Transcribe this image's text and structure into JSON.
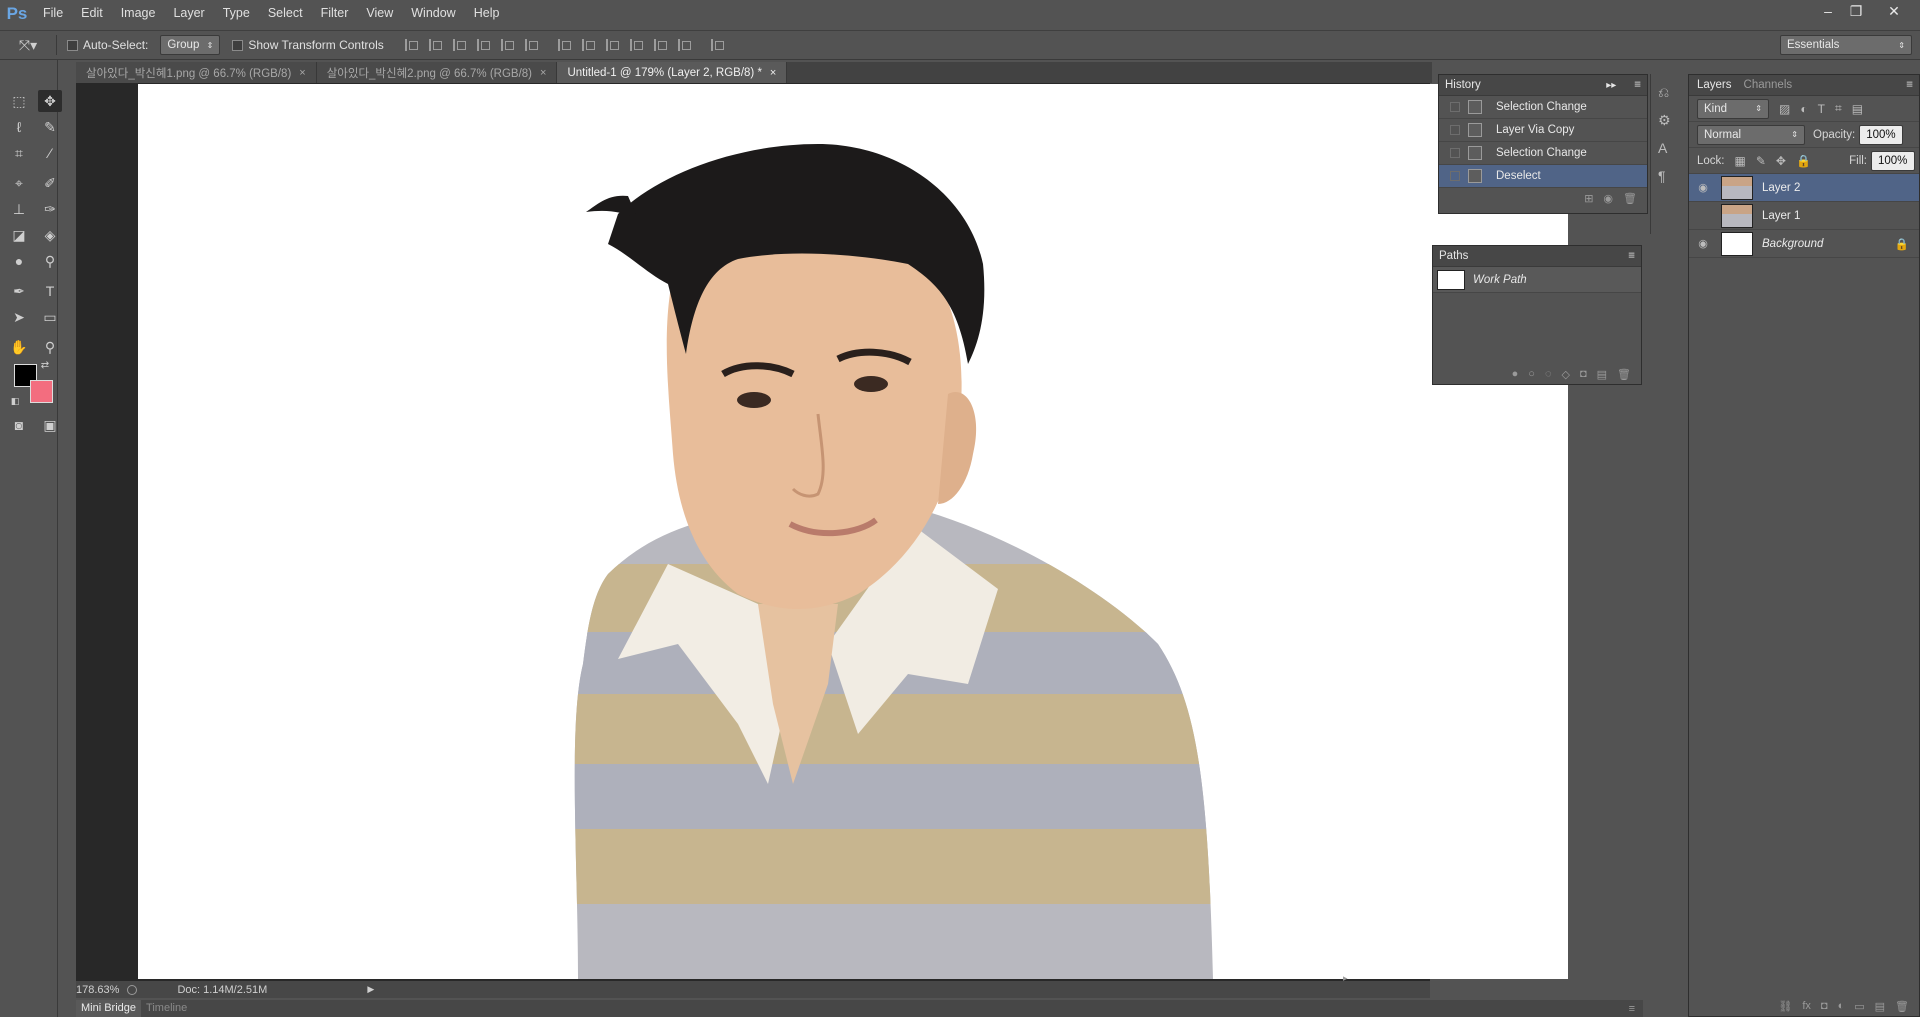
{
  "app": {
    "logo": "Ps"
  },
  "menu": [
    "File",
    "Edit",
    "Image",
    "Layer",
    "Type",
    "Select",
    "Filter",
    "View",
    "Window",
    "Help"
  ],
  "window_controls": {
    "minimize": "–",
    "restore": "❐",
    "close": "✕"
  },
  "options": {
    "auto_select_label": "Auto-Select:",
    "auto_select_value": "Group",
    "show_transform_label": "Show Transform Controls",
    "workspace": "Essentials"
  },
  "tabs": [
    {
      "label": "살아있다_박신혜1.png @ 66.7% (RGB/8)",
      "close": "×"
    },
    {
      "label": "살아있다_박신혜2.png @ 66.7% (RGB/8)",
      "close": "×"
    },
    {
      "label": "Untitled-1 @ 179% (Layer 2, RGB/8) *",
      "close": "×"
    }
  ],
  "status": {
    "zoom": "178.63%",
    "doc": "Doc: 1.14M/2.51M"
  },
  "bottom_tabs": [
    "Mini Bridge",
    "Timeline"
  ],
  "history": {
    "title": "History",
    "items": [
      "Selection Change",
      "Layer Via Copy",
      "Selection Change",
      "Deselect"
    ]
  },
  "paths": {
    "title": "Paths",
    "items": [
      "Work Path"
    ]
  },
  "layers_panel": {
    "tabs": [
      "Layers",
      "Channels"
    ],
    "filter": "Kind",
    "blend_mode": "Normal",
    "opacity_label": "Opacity:",
    "opacity": "100%",
    "lock_label": "Lock:",
    "fill_label": "Fill:",
    "fill": "100%",
    "layers": [
      "Layer 2",
      "Layer 1",
      "Background"
    ]
  },
  "colors": {
    "foreground": "#000000",
    "background": "#f36d7f",
    "selection": "#506487"
  }
}
